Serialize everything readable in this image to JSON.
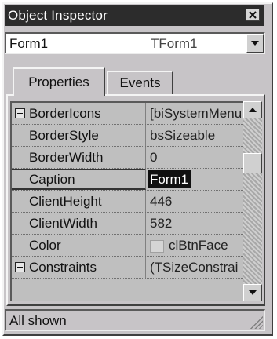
{
  "window": {
    "title": "Object Inspector",
    "close_icon": "close-icon"
  },
  "object_selector": {
    "name": "Form1",
    "type": "TForm1",
    "dropdown_icon": "chevron-down-icon"
  },
  "tabs": [
    {
      "label": "Properties",
      "active": true
    },
    {
      "label": "Events",
      "active": false
    }
  ],
  "properties": [
    {
      "name": "BorderIcons",
      "value": "[biSystemMenu",
      "expandable": true,
      "selected": false
    },
    {
      "name": "BorderStyle",
      "value": "bsSizeable",
      "expandable": false,
      "selected": false
    },
    {
      "name": "BorderWidth",
      "value": "0",
      "expandable": false,
      "selected": false
    },
    {
      "name": "Caption",
      "value": "Form1",
      "expandable": false,
      "selected": true
    },
    {
      "name": "ClientHeight",
      "value": "446",
      "expandable": false,
      "selected": false
    },
    {
      "name": "ClientWidth",
      "value": "582",
      "expandable": false,
      "selected": false
    },
    {
      "name": "Color",
      "value": "clBtnFace",
      "expandable": false,
      "selected": false,
      "swatch_color": "#d5d5d5"
    },
    {
      "name": "Constraints",
      "value": "(TSizeConstrai",
      "expandable": true,
      "selected": false
    }
  ],
  "status": {
    "text": "All shown"
  },
  "colors": {
    "titlebar": "#2c2c2c",
    "face": "#c7c4c7",
    "selection": "#101010"
  }
}
